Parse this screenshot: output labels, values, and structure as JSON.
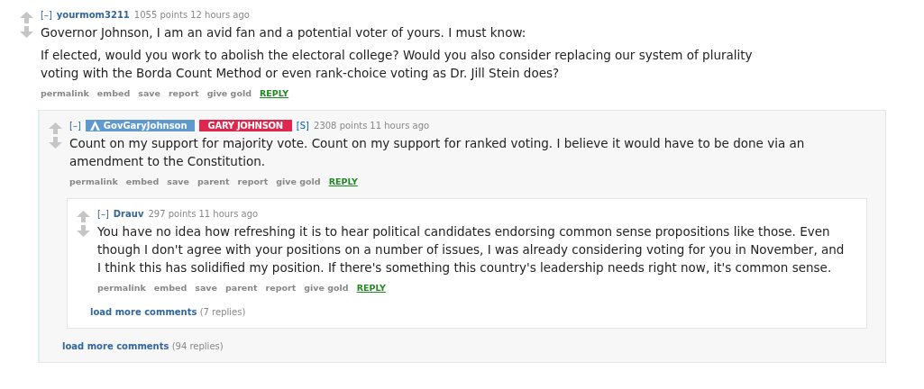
{
  "comments": [
    {
      "collapse": "[–]",
      "author": "yourmom3211",
      "highlighted": false,
      "points": "1055 points",
      "time": "12 hours ago",
      "paragraphs": [
        "Governor Johnson, I am an avid fan and a potential voter of yours. I must know:",
        "If elected, would you work to abolish the electoral college? Would you also consider replacing our system of plurality voting with the Borda Count Method or even rank-choice voting as Dr. Jill Stein does?"
      ],
      "actions": [
        "permalink",
        "embed",
        "save",
        "report",
        "give gold"
      ],
      "reply": "REPLY",
      "children": [
        {
          "collapse": "[–]",
          "author": "GovGaryJohnson",
          "highlighted": true,
          "tags": [
            {
              "kind": "flair",
              "text": "GARY JOHNSON"
            },
            {
              "kind": "submitter",
              "text": "[S]"
            }
          ],
          "points": "2308 points",
          "time": "11 hours ago",
          "paragraphs": [
            "Count on my support for majority vote. Count on my support for ranked voting. I believe it would have to be done via an amendment to the Constitution."
          ],
          "actions": [
            "permalink",
            "embed",
            "save",
            "parent",
            "report",
            "give gold"
          ],
          "reply": "REPLY",
          "children": [
            {
              "collapse": "[–]",
              "author": "Drauv",
              "highlighted": false,
              "points": "297 points",
              "time": "11 hours ago",
              "paragraphs": [
                "You have no idea how refreshing it is to hear political candidates endorsing common sense propositions like those. Even though I don't agree with your positions on a number of issues, I was already considering voting for you in November, and I think this has solidified my position. If there's something this country's leadership needs right now, it's common sense."
              ],
              "actions": [
                "permalink",
                "embed",
                "save",
                "parent",
                "report",
                "give gold"
              ],
              "reply": "REPLY",
              "more": {
                "label": "load more comments",
                "count": "(7 replies)"
              }
            }
          ],
          "more": {
            "label": "load more comments",
            "count": "(94 replies)"
          }
        }
      ]
    }
  ]
}
